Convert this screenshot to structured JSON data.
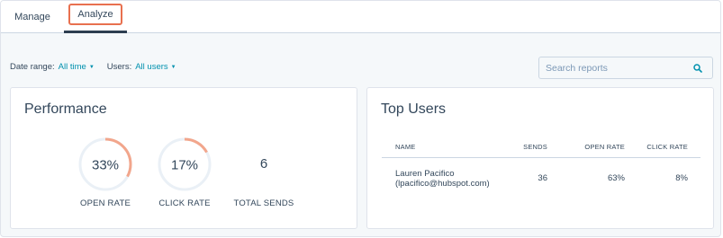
{
  "tabs": [
    {
      "label": "Manage",
      "active": false
    },
    {
      "label": "Analyze",
      "active": true
    }
  ],
  "filters": {
    "date_range_label": "Date range:",
    "date_range_value": "All time",
    "users_label": "Users:",
    "users_value": "All users"
  },
  "search": {
    "placeholder": "Search reports",
    "value": ""
  },
  "performance": {
    "title": "Performance",
    "open_rate": {
      "value": "33%",
      "fraction": 0.33,
      "label": "OPEN RATE"
    },
    "click_rate": {
      "value": "17%",
      "fraction": 0.17,
      "label": "CLICK RATE"
    },
    "total_sends": {
      "value": "6",
      "label": "TOTAL SENDS"
    }
  },
  "top_users": {
    "title": "Top Users",
    "columns": [
      "NAME",
      "SENDS",
      "OPEN RATE",
      "CLICK RATE"
    ],
    "rows": [
      {
        "name": "Lauren Pacifico",
        "email": "(lpacifico@hubspot.com)",
        "sends": "36",
        "open_rate": "63%",
        "click_rate": "8%"
      }
    ]
  },
  "colors": {
    "accent": "#e8704f",
    "donut_fill": "#f2a68c",
    "donut_track": "#eaf0f6",
    "link": "#0091ae",
    "text": "#33475b"
  }
}
